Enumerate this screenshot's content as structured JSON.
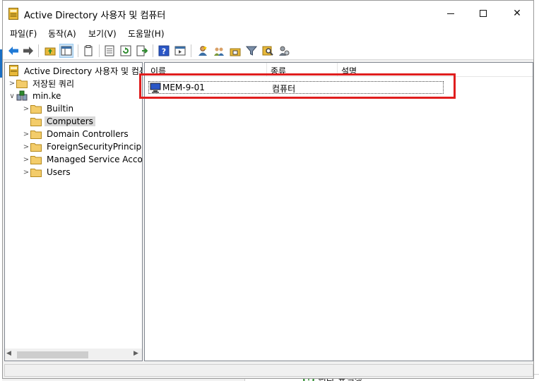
{
  "window": {
    "title": "Active Directory 사용자 및 컴퓨터",
    "controls": {
      "minimize_label": "",
      "maximize_label": "",
      "close_label": "✕"
    }
  },
  "menubar": [
    "파일(F)",
    "동작(A)",
    "보기(V)",
    "도움말(H)"
  ],
  "toolbar": {
    "icons": [
      "back-arrow-icon",
      "forward-arrow-icon",
      "up-folder-icon",
      "show-hide-console-tree-icon",
      "copy-icon",
      "properties-icon",
      "refresh-icon",
      "export-list-icon",
      "help-icon",
      "console-view-icon",
      "new-user-icon",
      "new-group-icon",
      "new-ou-icon",
      "filter-icon",
      "find-icon",
      "delegate-control-icon"
    ]
  },
  "tree": {
    "root": "Active Directory 사용자 및 컴퓨터",
    "saved_queries": "저장된 쿼리",
    "domain": "min.ke",
    "children": [
      "Builtin",
      "Computers",
      "Domain Controllers",
      "ForeignSecurityPrincipals",
      "Managed Service Accounts",
      "Users"
    ],
    "selected": "Computers"
  },
  "list": {
    "columns": [
      "이름",
      "종류",
      "설명"
    ],
    "rows": [
      {
        "name": "MEM-9-01",
        "type": "컴퓨터",
        "description": ""
      }
    ]
  },
  "background": {
    "partial_text": "린다 표절장"
  },
  "colors": {
    "highlight": "#e01e1e",
    "selection": "#d9d9d9",
    "folder": "#e8b93a"
  }
}
